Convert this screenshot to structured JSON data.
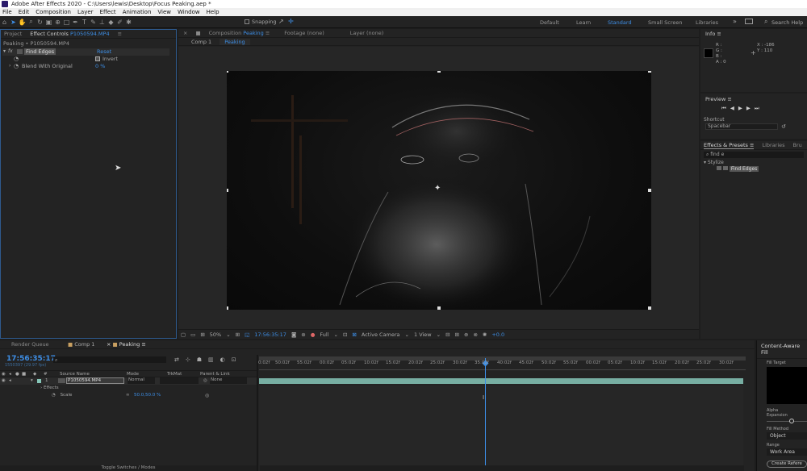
{
  "app": {
    "title": "Adobe After Effects 2020 - C:\\Users\\lewis\\Desktop\\Focus Peaking.aep *"
  },
  "menu": [
    "File",
    "Edit",
    "Composition",
    "Layer",
    "Effect",
    "Animation",
    "View",
    "Window",
    "Help"
  ],
  "toolbar": {
    "snapping": "Snapping"
  },
  "workspaces": [
    "Default",
    "Learn",
    "Standard",
    "Small Screen",
    "Libraries"
  ],
  "workspace_active": "Standard",
  "help_search": "Search Help",
  "left_panel": {
    "tab_project": "Project",
    "tab_effect_controls": "Effect Controls",
    "tab_effect_target": "P1050594.MP4",
    "subtitle": "Peaking • P1050594.MP4",
    "effect_name": "Find Edges",
    "reset": "Reset",
    "invert_label": "Invert",
    "blend_label": "Blend With Original",
    "blend_value": "0 %"
  },
  "comp_panel": {
    "tab_prefix": "Composition",
    "tab_name": "Peaking",
    "footage": "Footage (none)",
    "layer": "Layer (none)",
    "crumbs": [
      "Comp 1",
      "Peaking"
    ]
  },
  "viewer_bar": {
    "zoom": "50%",
    "timecode": "17:56:35:17",
    "resolution": "Full",
    "camera": "Active Camera",
    "views": "1 View",
    "exposure": "+0.0"
  },
  "info_panel": {
    "title": "Info",
    "r": "R :",
    "g": "G :",
    "b": "B :",
    "a": "A : 0",
    "x": "X : -186",
    "y": "Y : 110"
  },
  "preview_panel": {
    "title": "Preview",
    "shortcut_label": "Shortcut",
    "shortcut_value": "Spacebar"
  },
  "effects_panel": {
    "tab": "Effects & Presets",
    "tab_libraries": "Libraries",
    "tab_extra": "Bru",
    "search": "find e",
    "category": "Stylize",
    "result": "Find Edges"
  },
  "timeline": {
    "tabs": [
      "Render Queue",
      "Comp 1",
      "Peaking"
    ],
    "active_tab": "Peaking",
    "timecode": "17:56:35:17",
    "frame_info": "1550397 (29.97 fps)",
    "search": "",
    "columns": [
      "Source Name",
      "Mode",
      "TrkMat",
      "Parent & Link"
    ],
    "layer_num": "1",
    "layer_name": "P1050594.MP4",
    "layer_mode": "Normal",
    "layer_parent": "None",
    "effects_label": "Effects",
    "scale_label": "Scale",
    "scale_value": "50.0,50.0 %",
    "toggle_label": "Toggle Switches / Modes",
    "ruler": [
      "0:02f",
      "50:02f",
      "55:02f",
      "00:02f",
      "05:02f",
      "10:02f",
      "15:02f",
      "20:02f",
      "25:02f",
      "30:02f",
      "35:02f",
      "40:02f",
      "45:02f",
      "50:02f",
      "55:02f",
      "00:02f",
      "05:02f",
      "10:02f",
      "15:02f",
      "20:02f",
      "25:02f",
      "30:02f"
    ]
  },
  "caf_panel": {
    "title": "Content-Aware Fill",
    "fill_target": "Fill Target",
    "alpha_expansion": "Alpha Expansion",
    "fill_method_label": "Fill Method",
    "fill_method_value": "Object",
    "range_label": "Range",
    "range_value": "Work Area",
    "create_button": "Create Refere"
  },
  "colors": {
    "accent": "#3d8ee6",
    "panel": "#232323",
    "bg": "#1d1d1d",
    "teal": "#86c7b8"
  }
}
